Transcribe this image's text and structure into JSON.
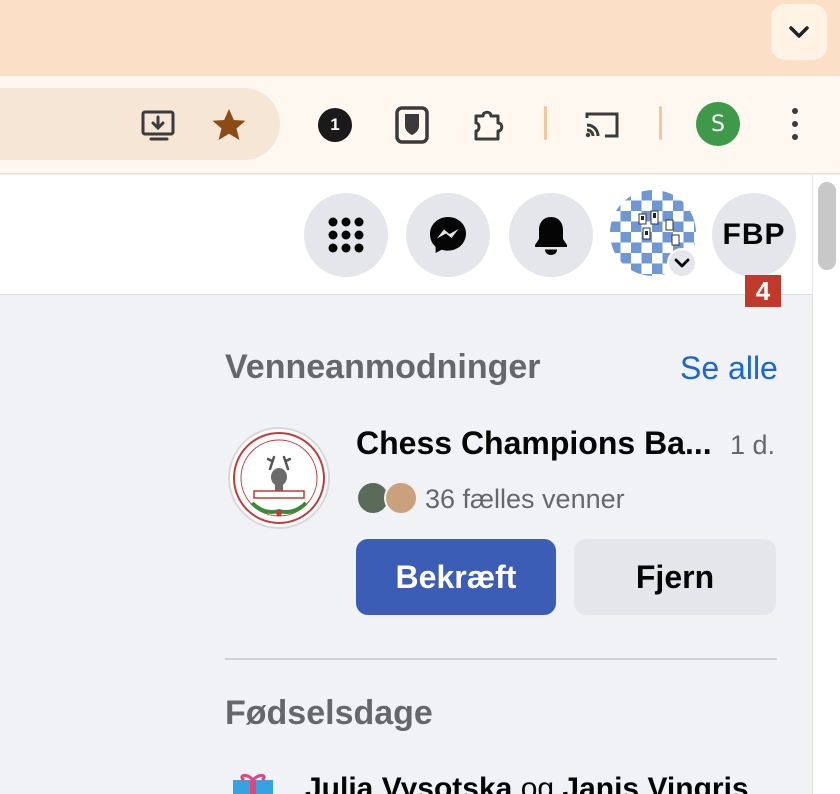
{
  "browser": {
    "tab_dropdown_icon": "chevron-down-icon",
    "toolbar_icons": [
      "install-app-icon",
      "bookmark-star-icon",
      "1password-icon",
      "bitwarden-shield-icon",
      "extensions-puzzle-icon",
      "cast-icon",
      "more-menu-icon"
    ],
    "profile_initial": "S",
    "password_manager_label": "1",
    "colors": {
      "tabstrip": "#fbdfc6",
      "toolbar": "#fff8f1",
      "profile": "#3e9a4a"
    }
  },
  "header": {
    "menu_icon": "apps-grid-icon",
    "messenger_icon": "messenger-icon",
    "notifications_icon": "bell-icon",
    "account_chevron_icon": "chevron-down-icon",
    "page_button_label": "FBP",
    "badge_count": "4"
  },
  "friend_requests": {
    "title": "Venneanmodninger",
    "see_all": "Se alle",
    "items": [
      {
        "name": "Chess Champions Ba...",
        "time": "1 d.",
        "mutual_friends": "36 fælles venner",
        "confirm_label": "Bekræft",
        "remove_label": "Fjern"
      }
    ]
  },
  "birthdays": {
    "title": "Fødselsdage",
    "name1": "Julia Vysotska",
    "joiner": "og",
    "name2": "Janis Vingris"
  },
  "colors": {
    "primary_button": "#3b5db5",
    "link": "#1a66d6",
    "badge": "#c0392b"
  }
}
